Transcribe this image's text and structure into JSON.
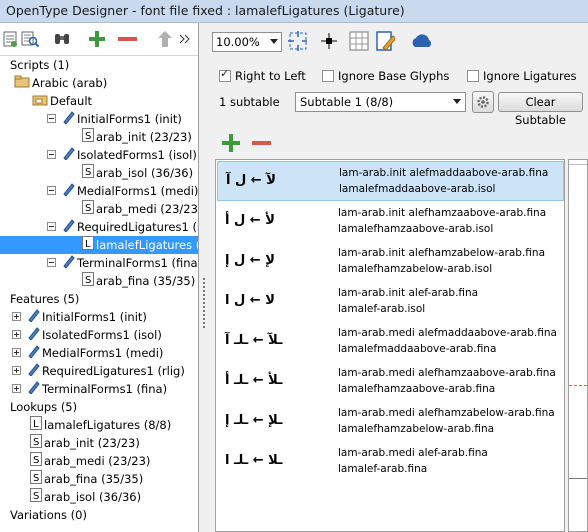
{
  "window": {
    "title": "OpenType Designer - font file fixed : lamalefLigatures (Ligature)"
  },
  "tree": {
    "scripts_label": "Scripts (1)",
    "arabic_label": "Arabic (arab)",
    "default_label": "Default",
    "features_label": "Features (5)",
    "lookups_label": "Lookups (5)",
    "variations_label": "Variations (0)",
    "default_items": [
      {
        "feature": "InitialForms1 (init)",
        "lookup": "arab_init (23/23)"
      },
      {
        "feature": "IsolatedForms1 (isol)",
        "lookup": "arab_isol (36/36)"
      },
      {
        "feature": "MedialForms1 (medi)",
        "lookup": "arab_medi (23/23)"
      },
      {
        "feature": "RequiredLigatures1 (r",
        "lookup": "lamalefLigatures ("
      },
      {
        "feature": "TerminalForms1 (fina",
        "lookup": "arab_fina (35/35)"
      }
    ],
    "features": [
      "InitialForms1 (init)",
      "IsolatedForms1 (isol)",
      "MedialForms1 (medi)",
      "RequiredLigatures1 (rlig)",
      "TerminalForms1 (fina)"
    ],
    "lookups": [
      {
        "type": "L",
        "label": "lamalefLigatures (8/8)"
      },
      {
        "type": "S",
        "label": "arab_init (23/23)"
      },
      {
        "type": "S",
        "label": "arab_medi (23/23)"
      },
      {
        "type": "S",
        "label": "arab_fina (35/35)"
      },
      {
        "type": "S",
        "label": "arab_isol (36/36)"
      }
    ]
  },
  "toolbar": {
    "zoom_value": "10.00%"
  },
  "options": {
    "right_to_left": "Right to Left",
    "ignore_base": "Ignore Base Glyphs",
    "ignore_ligatures": "Ignore Ligatures",
    "right_to_left_checked": true
  },
  "subtable": {
    "count_label": "1 subtable",
    "selected": "Subtable 1 (8/8)",
    "clear_label": "Clear Subtable"
  },
  "ligatures": [
    {
      "glyph": "لآ ← ل آ",
      "rule": "lam-arab.init alefmaddaabove-arab.fina",
      "result": "lamalefmaddaabove-arab.isol"
    },
    {
      "glyph": "لأ ← ل أ",
      "rule": "lam-arab.init alefhamzaabove-arab.fina",
      "result": "lamalefhamzaabove-arab.isol"
    },
    {
      "glyph": "لإ ← ل إ",
      "rule": "lam-arab.init alefhamzabelow-arab.fina",
      "result": "lamalefhamzabelow-arab.isol"
    },
    {
      "glyph": "لا ← ل ا",
      "rule": "lam-arab.init alef-arab.fina",
      "result": "lamalef-arab.isol"
    },
    {
      "glyph": "ـلآ ← ـلـ آ",
      "rule": "lam-arab.medi alefmaddaabove-arab.fina",
      "result": "lamalefmaddaabove-arab.fina"
    },
    {
      "glyph": "ـلأ ← ـلـ أ",
      "rule": "lam-arab.medi alefhamzaabove-arab.fina",
      "result": "lamalefhamzaabove-arab.fina"
    },
    {
      "glyph": "ـلإ ← ـلـ إ",
      "rule": "lam-arab.medi alefhamzabelow-arab.fina",
      "result": "lamalefhamzabelow-arab.fina"
    },
    {
      "glyph": "ـلا ← ـلـ ا",
      "rule": "lam-arab.medi alef-arab.fina",
      "result": "lamalef-arab.fina"
    }
  ],
  "colors": {
    "accent_green": "#3c9a3c",
    "accent_red": "#d9534f",
    "selection": "#3399ff",
    "row_highlight": "#cde4f7"
  }
}
